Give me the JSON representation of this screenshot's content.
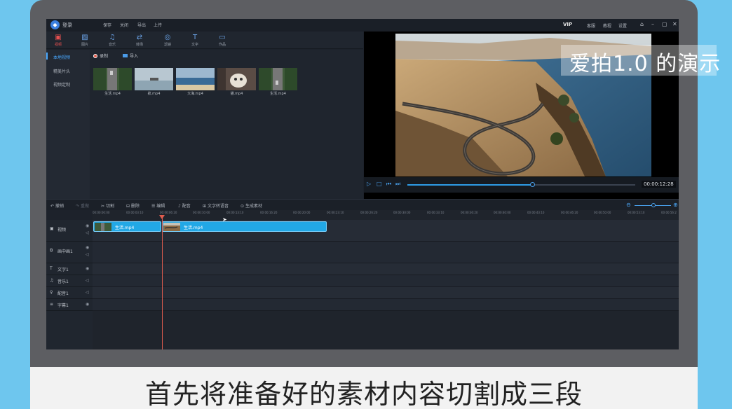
{
  "title_bar": {
    "login": "登录",
    "menu": [
      "保存",
      "关闭",
      "导出",
      "上传"
    ],
    "vip": "VIP",
    "right_menu": [
      "客服",
      "教程",
      "设置"
    ]
  },
  "toolbar": [
    {
      "label": "视频",
      "icon": "film-icon",
      "active": true
    },
    {
      "label": "图片",
      "icon": "image-icon",
      "active": false
    },
    {
      "label": "音乐",
      "icon": "music-icon",
      "active": false
    },
    {
      "label": "转场",
      "icon": "transition-icon",
      "active": false
    },
    {
      "label": "滤镜",
      "icon": "filter-icon",
      "active": false
    },
    {
      "label": "文字",
      "icon": "text-icon",
      "active": false
    },
    {
      "label": "作品",
      "icon": "folder-icon",
      "active": false
    }
  ],
  "sidebar": [
    "本地视频",
    "精美片头",
    "视频定制"
  ],
  "media": {
    "record": "录制",
    "import": "导入",
    "items": [
      "生活.mp4",
      "航.mp4",
      "大海.mp4",
      "猫.mp4",
      "生活.mp4"
    ]
  },
  "preview": {
    "time": "00:00:12:28"
  },
  "watermark": "爱拍1.0 的演示",
  "timeline_tools": [
    {
      "label": "撤销",
      "dim": false
    },
    {
      "label": "重做",
      "dim": true
    },
    {
      "label": "切割",
      "dim": false
    },
    {
      "label": "删除",
      "dim": false
    },
    {
      "label": "编辑",
      "dim": false
    },
    {
      "label": "配音",
      "dim": false
    },
    {
      "label": "文字转语音",
      "dim": false
    },
    {
      "label": "生成素材",
      "dim": false
    }
  ],
  "ruler": [
    "00:00:00:00",
    "00:00:03:10",
    "00:00:06:20",
    "00:00:10:00",
    "00:00:13:10",
    "00:00:16:20",
    "00:00:20:00",
    "00:00:23:10",
    "00:00:26:20",
    "00:00:30:00",
    "00:00:33:10",
    "00:00:36:20",
    "00:00:40:00",
    "00:00:43:10",
    "00:00:46:20",
    "00:00:50:00",
    "00:00:53:10",
    "00:00:56:2"
  ],
  "tracks": [
    {
      "label": "视频",
      "icon": "film-icon"
    },
    {
      "label": "画中画1",
      "icon": "pip-icon"
    },
    {
      "label": "文字1",
      "icon": "text-icon"
    },
    {
      "label": "音乐1",
      "icon": "music-icon"
    },
    {
      "label": "配音1",
      "icon": "mic-icon"
    },
    {
      "label": "字幕1",
      "icon": "subtitle-icon"
    }
  ],
  "clips": [
    "生活.mp4",
    "生活.mp4"
  ],
  "caption": "首先将准备好的素材内容切割成三段"
}
